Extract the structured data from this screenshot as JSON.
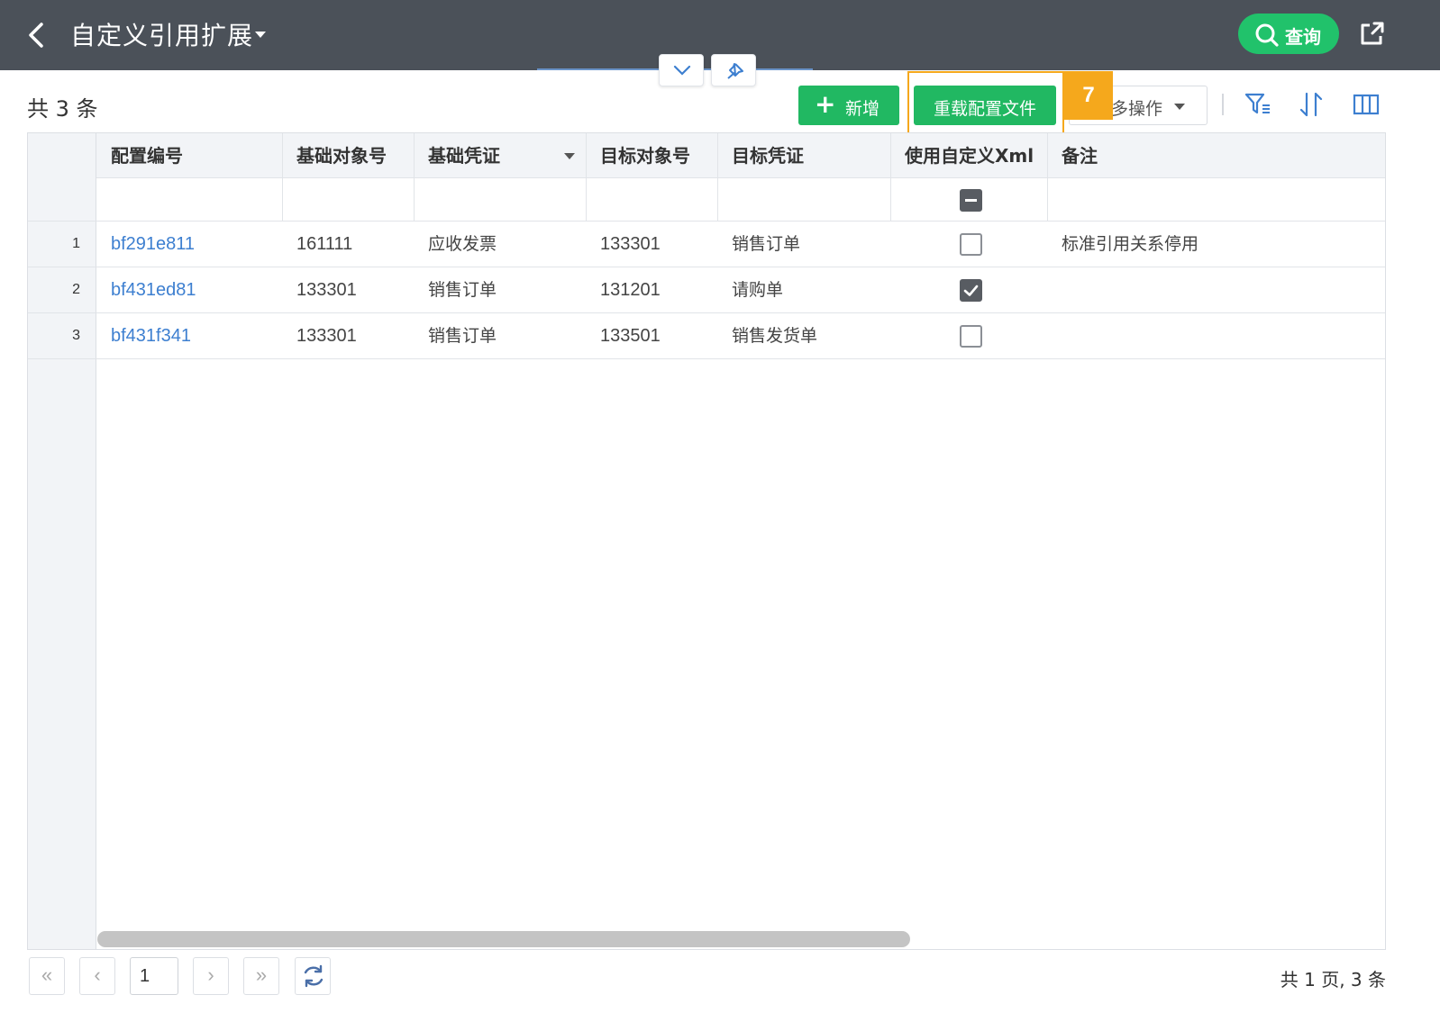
{
  "header": {
    "title": "自定义引用扩展",
    "search_label": "查询"
  },
  "toolbar": {
    "count_text": "共 3 条",
    "add_label": "新增",
    "reload_label": "重载配置文件",
    "more_ops_label": "多操作",
    "step_badge": "7"
  },
  "table": {
    "columns": [
      "配置编号",
      "基础对象号",
      "基础凭证",
      "目标对象号",
      "目标凭证",
      "使用自定义Xml",
      "备注"
    ],
    "rows": [
      {
        "index": "1",
        "config_no": "bf291e811",
        "base_obj": "161111",
        "base_doc": "应收发票",
        "target_obj": "133301",
        "target_doc": "销售订单",
        "use_xml": false,
        "remark": "标准引用关系停用"
      },
      {
        "index": "2",
        "config_no": "bf431ed81",
        "base_obj": "133301",
        "base_doc": "销售订单",
        "target_obj": "131201",
        "target_doc": "请购单",
        "use_xml": true,
        "remark": ""
      },
      {
        "index": "3",
        "config_no": "bf431f341",
        "base_obj": "133301",
        "base_doc": "销售订单",
        "target_obj": "133501",
        "target_doc": "销售发货单",
        "use_xml": false,
        "remark": ""
      }
    ]
  },
  "pager": {
    "first": "«",
    "prev": "‹",
    "next": "›",
    "last": "»",
    "page": "1",
    "info": "共 1 页, 3 条"
  },
  "colors": {
    "header_bg": "#4b5159",
    "green": "#21b862",
    "highlight": "#f5a81c",
    "link": "#3d7fd0"
  },
  "icons": [
    "chevron-left-icon",
    "caret-down-icon",
    "search-icon",
    "share-icon",
    "chevron-down-icon",
    "pin-icon",
    "plus-icon",
    "filter-icon",
    "sort-icon",
    "columns-icon",
    "refresh-icon"
  ]
}
